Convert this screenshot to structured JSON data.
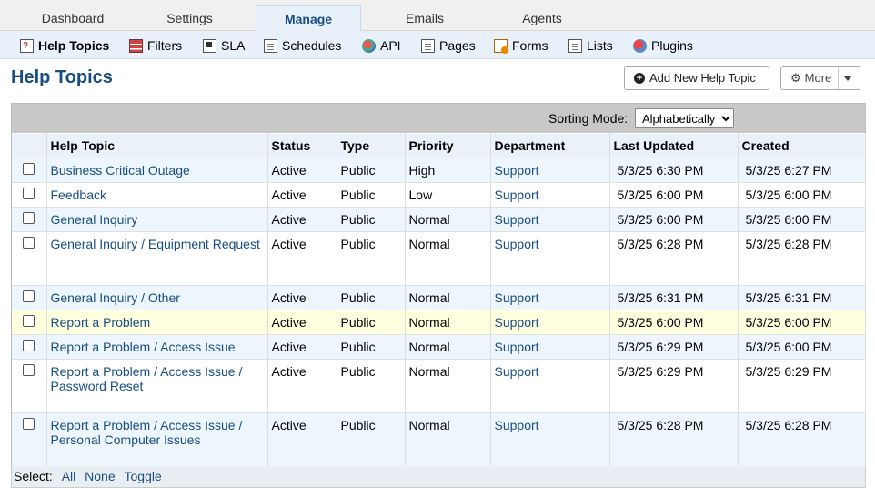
{
  "top_tabs": [
    {
      "label": "Dashboard"
    },
    {
      "label": "Settings"
    },
    {
      "label": "Manage"
    },
    {
      "label": "Emails"
    },
    {
      "label": "Agents"
    }
  ],
  "sub_nav": [
    {
      "label": "Help Topics",
      "icon": "help-topics-icon"
    },
    {
      "label": "Filters",
      "icon": "filters-icon"
    },
    {
      "label": "SLA",
      "icon": "sla-icon"
    },
    {
      "label": "Schedules",
      "icon": "schedules-icon"
    },
    {
      "label": "API",
      "icon": "api-icon"
    },
    {
      "label": "Pages",
      "icon": "pages-icon"
    },
    {
      "label": "Forms",
      "icon": "forms-icon"
    },
    {
      "label": "Lists",
      "icon": "lists-icon"
    },
    {
      "label": "Plugins",
      "icon": "plugins-icon"
    }
  ],
  "page": {
    "title": "Help Topics",
    "add_button": "Add New Help Topic",
    "more_button": "More"
  },
  "sorting": {
    "label": "Sorting Mode:",
    "selected": "Alphabetically"
  },
  "table": {
    "columns": [
      "Help Topic",
      "Status",
      "Type",
      "Priority",
      "Department",
      "Last Updated",
      "Created"
    ],
    "rows": [
      {
        "topic": "Business Critical Outage",
        "status": "Active",
        "type": "Public",
        "priority": "High",
        "department": "Support",
        "updated": "5/3/25 6:30 PM",
        "created": "5/3/25 6:27 PM"
      },
      {
        "topic": "Feedback",
        "status": "Active",
        "type": "Public",
        "priority": "Low",
        "department": "Support",
        "updated": "5/3/25 6:00 PM",
        "created": "5/3/25 6:00 PM"
      },
      {
        "topic": "General Inquiry",
        "status": "Active",
        "type": "Public",
        "priority": "Normal",
        "department": "Support",
        "updated": "5/3/25 6:00 PM",
        "created": "5/3/25 6:00 PM"
      },
      {
        "topic": "General Inquiry / Equipment Request",
        "status": "Active",
        "type": "Public",
        "priority": "Normal",
        "department": "Support",
        "updated": "5/3/25 6:28 PM",
        "created": "5/3/25 6:28 PM"
      },
      {
        "topic": "General Inquiry / Other",
        "status": "Active",
        "type": "Public",
        "priority": "Normal",
        "department": "Support",
        "updated": "5/3/25 6:31 PM",
        "created": "5/3/25 6:31 PM"
      },
      {
        "topic": "Report a Problem",
        "status": "Active",
        "type": "Public",
        "priority": "Normal",
        "department": "Support",
        "updated": "5/3/25 6:00 PM",
        "created": "5/3/25 6:00 PM"
      },
      {
        "topic": "Report a Problem / Access Issue",
        "status": "Active",
        "type": "Public",
        "priority": "Normal",
        "department": "Support",
        "updated": "5/3/25 6:29 PM",
        "created": "5/3/25 6:00 PM"
      },
      {
        "topic": "Report a Problem / Access Issue / Password Reset",
        "status": "Active",
        "type": "Public",
        "priority": "Normal",
        "department": "Support",
        "updated": "5/3/25 6:29 PM",
        "created": "5/3/25 6:29 PM"
      },
      {
        "topic": "Report a Problem / Access Issue / Personal Computer Issues",
        "status": "Active",
        "type": "Public",
        "priority": "Normal",
        "department": "Support",
        "updated": "5/3/25 6:28 PM",
        "created": "5/3/25 6:28 PM"
      }
    ]
  },
  "footer": {
    "select_label": "Select:",
    "all": "All",
    "none": "None",
    "toggle": "Toggle"
  },
  "colors": {
    "link": "#184E81",
    "row_alt": "#eef6fd",
    "row_highlight": "#ffffe0",
    "sortbar": "#c8c8c8"
  }
}
